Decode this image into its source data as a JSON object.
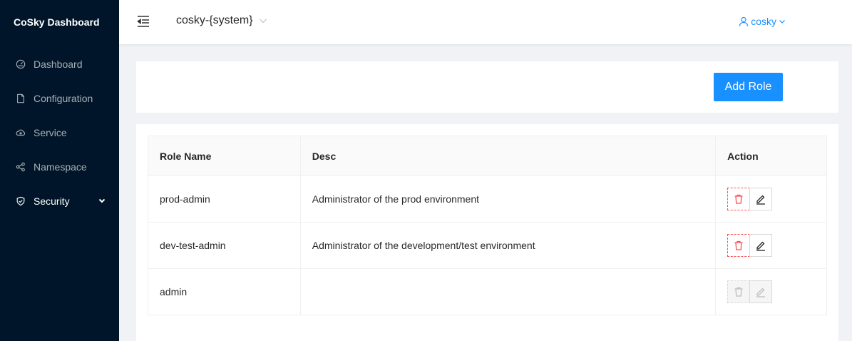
{
  "sidebar": {
    "logo": "CoSky Dashboard",
    "items": [
      {
        "label": "Dashboard",
        "icon": "dashboard-icon"
      },
      {
        "label": "Configuration",
        "icon": "file-icon"
      },
      {
        "label": "Service",
        "icon": "cloud-icon"
      },
      {
        "label": "Namespace",
        "icon": "cluster-icon"
      },
      {
        "label": "Security",
        "icon": "shield-icon"
      }
    ]
  },
  "header": {
    "namespace": "cosky-{system}",
    "user": "cosky"
  },
  "toolbar": {
    "add_role_label": "Add Role"
  },
  "table": {
    "columns": [
      "Role Name",
      "Desc",
      "Action"
    ],
    "rows": [
      {
        "name": "prod-admin",
        "desc": "Administrator of the prod environment",
        "editable": true
      },
      {
        "name": "dev-test-admin",
        "desc": "Administrator of the development/test environment",
        "editable": true
      },
      {
        "name": "admin",
        "desc": "",
        "editable": false
      }
    ]
  },
  "colors": {
    "sidebar_bg": "#001529",
    "primary": "#1890ff",
    "danger": "#ff4d4f"
  }
}
